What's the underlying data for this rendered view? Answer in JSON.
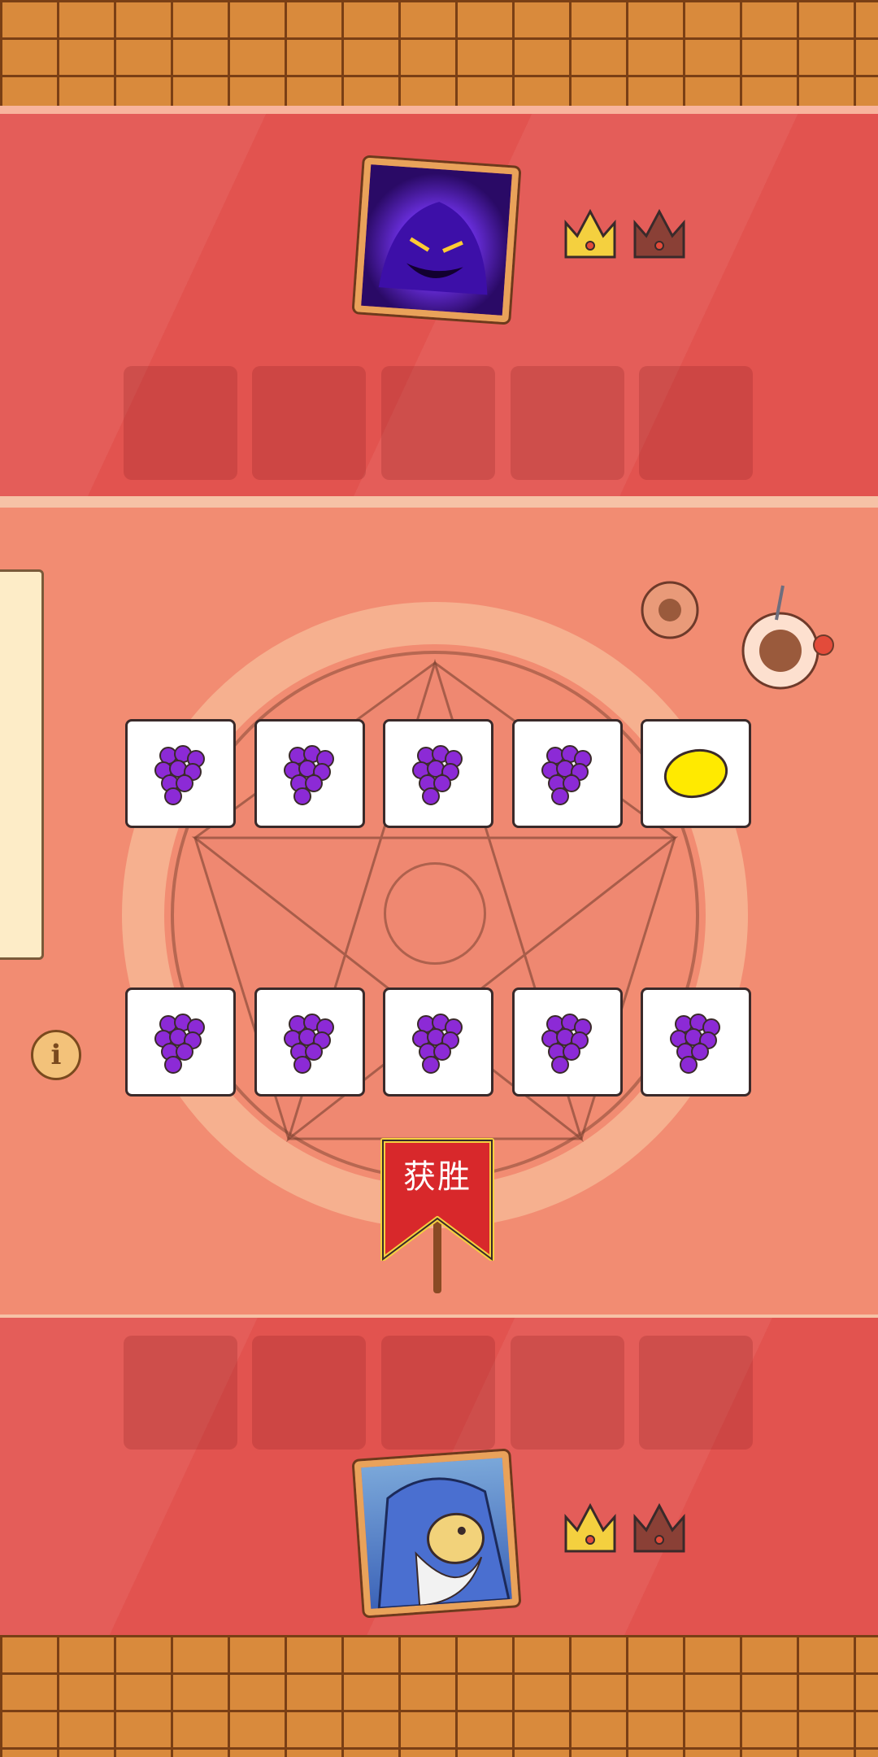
{
  "game": {
    "result_banner": "获胜",
    "opponent": {
      "portrait": "shadow-ghost-portrait",
      "crowns_won": 1,
      "crowns_total": 2
    },
    "player": {
      "portrait": "wizard-portrait",
      "crowns_won": 1,
      "crowns_total": 2
    },
    "top_row_cards": [
      "grapes",
      "grapes",
      "grapes",
      "grapes",
      "lemon"
    ],
    "bottom_row_cards": [
      "grapes",
      "grapes",
      "grapes",
      "grapes",
      "grapes"
    ],
    "opponent_slots": 5,
    "player_slots": 5
  },
  "colors": {
    "curtain": "#e2534f",
    "board": "#f28c72",
    "banner": "#d8282b",
    "grapes": "#8c2ad6",
    "lemon": "#ffea00",
    "crown_won": "#f4d03f",
    "crown_empty": "#8a4036"
  },
  "icons": {
    "info": "info-icon",
    "grapes": "grapes-icon",
    "lemon": "lemon-icon",
    "crown": "crown-icon"
  }
}
